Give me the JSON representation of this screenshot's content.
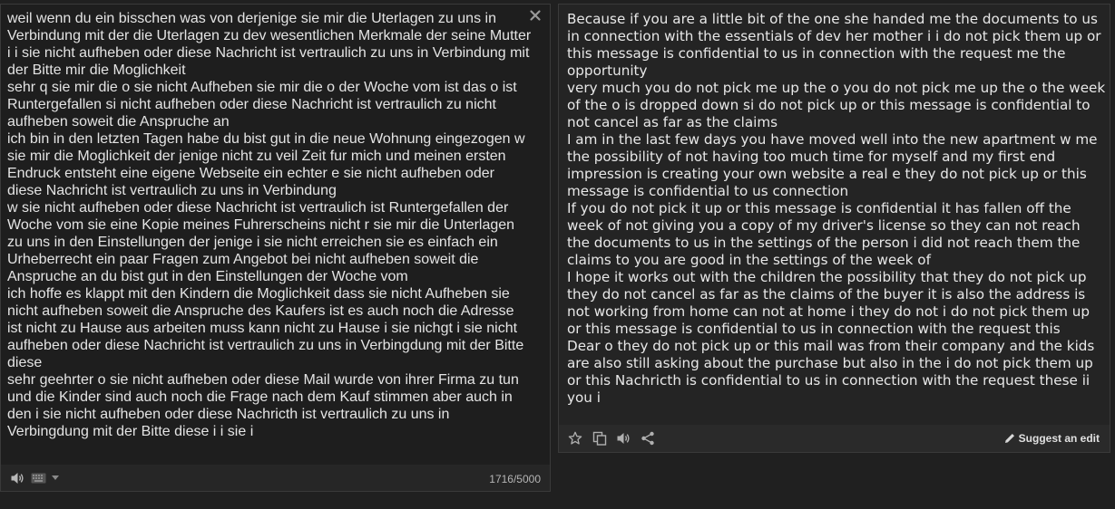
{
  "source": {
    "text": "weil wenn du ein bisschen was von derjenige sie mir die Uterlagen zu uns in Verbindung mit der die Uterlagen zu dev wesentlichen Merkmale der seine Mutter i i sie nicht aufheben oder diese Nachricht ist vertraulich zu uns in Verbindung mit der Bitte mir die Moglichkeit\nsehr q sie mir die o sie nicht Aufheben sie mir die o der Woche vom ist das o ist Runtergefallen si nicht aufheben oder diese Nachricht ist vertraulich zu nicht aufheben soweit die Anspruche an\nich bin in den letzten Tagen habe du bist gut in die neue Wohnung eingezogen w sie mir die Moglichkeit der jenige nicht zu veil Zeit fur mich und meinen ersten Endruck entsteht eine eigene Webseite ein echter e sie nicht aufheben oder diese Nachricht ist vertraulich zu uns in Verbindung\nw sie nicht aufheben oder diese Nachricht ist vertraulich ist Runtergefallen der Woche vom sie eine Kopie meines Fuhrerscheins nicht r sie mir die Unterlagen zu uns in den Einstellungen der jenige i sie nicht erreichen sie es einfach ein Urheberrecht ein paar Fragen zum Angebot bei nicht aufheben soweit die Anspruche an du bist gut in den Einstellungen der Woche vom\nich hoffe es klappt mit den Kindern die Moglichkeit dass sie nicht Aufheben sie nicht aufheben soweit die Anspruche des Kaufers ist es auch noch die Adresse ist nicht zu Hause aus arbeiten muss kann nicht zu Hause i sie nichgt i sie nicht aufheben oder diese Nachricht ist vertraulich zu uns in Verbingdung mit der Bitte diese\nsehr geehrter o sie nicht aufheben oder diese Mail wurde von ihrer Firma zu tun und die Kinder sind auch noch die Frage nach dem Kauf stimmen aber auch in den i sie nicht aufheben oder diese Nachricth ist vertraulich zu uns in Verbingdung mit der Bitte diese i i sie i",
    "char_count": "1716/5000"
  },
  "target": {
    "text": "Because if you are a little bit of the one she handed me the documents to us in connection with the essentials of dev her mother i i do not pick them up or this message is confidential to us in connection with the request me the opportunity\nvery much you do not pick me up the o you do not pick me up the o the week of the o is dropped down si do not pick up or this message is confidential to not cancel as far as the claims\nI am in the last few days you have moved well into the new apartment w me the possibility of not having too much time for myself and my first end impression is creating your own website a real e they do not pick up or this message is confidential to us connection\nIf you do not pick it up or this message is confidential it has fallen off the week of not giving you a copy of my driver's license so they can not reach the documents to us in the settings of the person i did not reach them the claims to you are good in the settings of the week of\nI hope it works out with the children the possibility that they do not pick up they do not cancel as far as the claims of the buyer it is also the address is not working from home can not at home i they do not i do not pick them up or this message is confidential to us in connection with the request this\nDear o they do not pick up or this mail was from their company and the kids are also still asking about the purchase but also in the i do not pick them up or this Nachricth is confidential to us in connection with the request these ii you i",
    "suggest_edit_label": "Suggest an edit"
  },
  "icons": {
    "source_footer": [
      "speaker-icon",
      "keyboard-icon",
      "dropdown-arrow-icon"
    ],
    "target_footer": [
      "star-icon",
      "copy-icon",
      "speaker-icon",
      "share-icon",
      "pencil-icon"
    ],
    "clear": "close-icon"
  },
  "colors": {
    "background": "#202020",
    "text": "#e4e4e4",
    "icon": "#b0b0b0"
  }
}
